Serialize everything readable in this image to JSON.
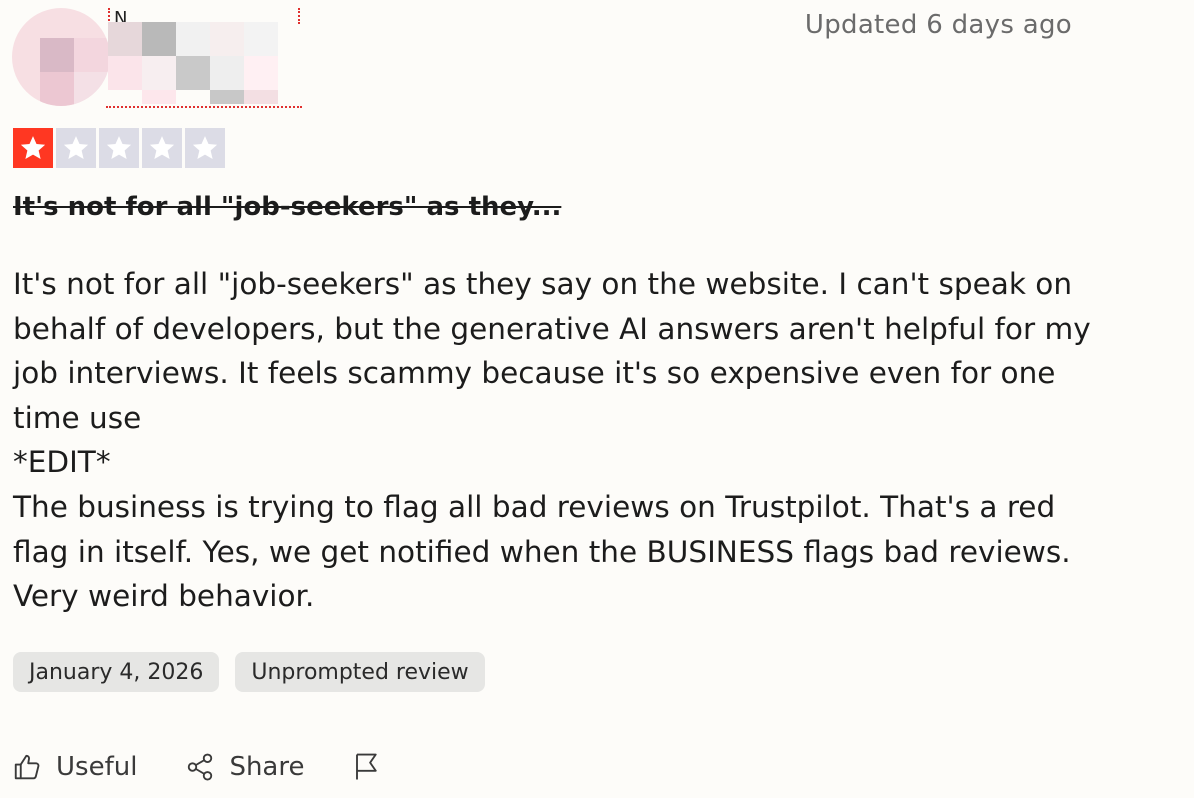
{
  "reviewer": {
    "name_glyph": "N",
    "avatar_pixels": [
      "#d9b9c6",
      "#f3d6de",
      "#ecc7d2",
      "#f4e0e6"
    ],
    "name_pixels": [
      "#e6d7da",
      "#b9b9b9",
      "#f1f1f1",
      "#c9c9c9",
      "#f6eeee",
      "#fbe4ea",
      "#dcdcdc",
      "#fff0f3"
    ]
  },
  "updated_label": "Updated 6 days ago",
  "rating": {
    "value": 1,
    "max": 5,
    "filled_color": "#ff3722",
    "empty_color": "#dcdce6"
  },
  "review": {
    "title": "It's not for all \"job-seekers\" as they...",
    "body_lines": [
      "It's not for all \"job-seekers\" as they say on the website. I can't speak on behalf of developers, but the generative AI answers aren't helpful for my job interviews. It feels scammy because it's so expensive even for one time use",
      "*EDIT*",
      "The business is trying to flag all bad reviews on Trustpilot. That's a red flag in itself. Yes, we get notified when the BUSINESS flags bad reviews. Very weird behavior."
    ],
    "date_chip": "January 4, 2026",
    "type_chip": "Unprompted review"
  },
  "actions": {
    "useful_label": "Useful",
    "share_label": "Share",
    "useful_icon": "thumbs-up-icon",
    "share_icon": "share-icon",
    "flag_icon": "flag-icon"
  }
}
